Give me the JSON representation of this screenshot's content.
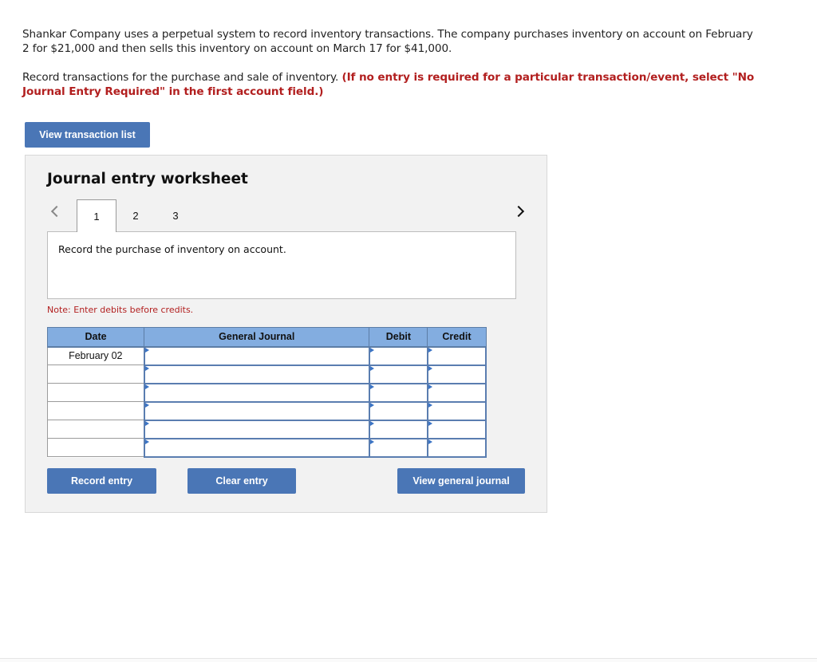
{
  "intro": {
    "paragraph1": "Shankar Company uses a perpetual system to record inventory transactions. The company purchases inventory on account on February 2 for $21,000 and then sells this inventory on account on March 17 for $41,000.",
    "paragraph2_plain": "Record transactions for the purchase and sale of inventory. ",
    "paragraph2_emphasis": "(If no entry is required for a particular transaction/event, select \"No Journal Entry Required\" in the first account field.)"
  },
  "buttons": {
    "view_transaction_list": "View transaction list",
    "record_entry": "Record entry",
    "clear_entry": "Clear entry",
    "view_general_journal": "View general journal"
  },
  "worksheet": {
    "title": "Journal entry worksheet",
    "tabs": [
      {
        "label": "1",
        "active": true
      },
      {
        "label": "2",
        "active": false
      },
      {
        "label": "3",
        "active": false
      }
    ],
    "prev_icon": "chevron-left-icon",
    "next_icon": "chevron-right-icon",
    "description": "Record the purchase of inventory on account.",
    "note": "Note: Enter debits before credits."
  },
  "journal": {
    "headers": {
      "date": "Date",
      "general_journal": "General Journal",
      "debit": "Debit",
      "credit": "Credit"
    },
    "rows": [
      {
        "date": "February 02",
        "account": "",
        "debit": "",
        "credit": ""
      },
      {
        "date": "",
        "account": "",
        "debit": "",
        "credit": ""
      },
      {
        "date": "",
        "account": "",
        "debit": "",
        "credit": ""
      },
      {
        "date": "",
        "account": "",
        "debit": "",
        "credit": ""
      },
      {
        "date": "",
        "account": "",
        "debit": "",
        "credit": ""
      },
      {
        "date": "",
        "account": "",
        "debit": "",
        "credit": ""
      }
    ]
  },
  "colors": {
    "button_blue": "#4a76b6",
    "header_blue": "#83ade0",
    "emphasis_red": "#b21f1f",
    "panel_gray": "#f2f2f2"
  }
}
